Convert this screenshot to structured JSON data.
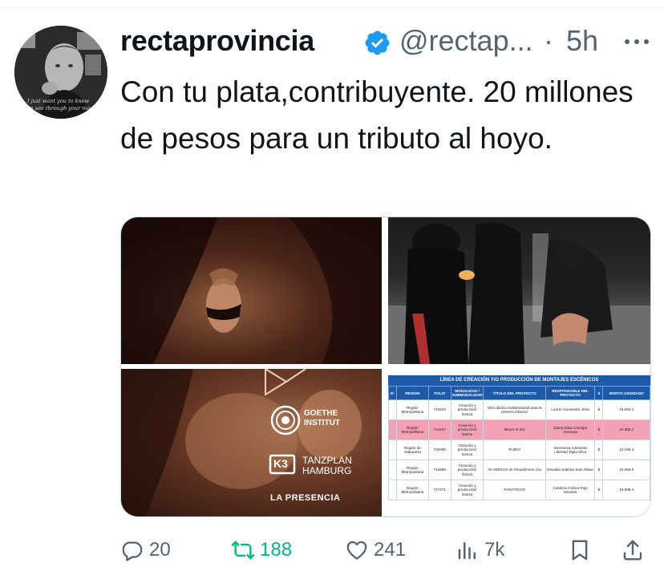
{
  "tweet": {
    "author_name": "rectaprovincia",
    "handle": "@rectap...",
    "separator": "·",
    "time": "5h",
    "text": "Con tu plata,contribuyente. 20 millones de pesos para un tributo al hoyo.",
    "avatar_caption_1": "I just want you to know",
    "avatar_caption_2": "can see through your mask"
  },
  "media": {
    "image_3": {
      "goethe_line1": "GOETHE",
      "goethe_line2": "INSTITUT",
      "tanzplan_line1": "TANZPLAN",
      "tanzplan_line2": "HAMBURG",
      "tanzplan_logo": "K3",
      "caption": "LA PRESENCIA"
    },
    "image_4": {
      "title": "LÍNEA DE CREACIÓN Y/O PRODUCCIÓN DE MONTAJES ESCÉNICOS",
      "headers": [
        "N°",
        "REGIÓN",
        "FOLIO",
        "MODALIDAD / SUBMODALIDAD",
        "TÍTULO DEL PROYECTO",
        "RESPONSABLE DEL PROYECTO",
        "$",
        "MONTO ASIGNADO"
      ],
      "rows": [
        [
          "",
          "Región Metropolitana",
          "716220",
          "Creación y producción/ Danza",
          "GEA danza multisensorial para la primera infancia",
          "Loreto Cavieedes Jerta",
          "$",
          "19.994.1"
        ],
        [
          "",
          "Región Metropolitana",
          "714187",
          "Creación y producción/ Danza",
          "Mover el Sur",
          "Diana Elisa Carvajal Guevara",
          "$",
          "19.955.2"
        ],
        [
          "",
          "Región de Valparaíso",
          "726480",
          "Creación y producción/ Danza",
          "RUIDO",
          "Genoveva Antonieta Libertad Tapia Silva",
          "$",
          "12.155.4"
        ],
        [
          "",
          "Región Metropolitana",
          "712885",
          "Creación y producción/ Danza",
          "IN VERSUS de Pseudónimo Cía",
          "Ninoska Sabrina Soto Olave",
          "$",
          "15.256.8"
        ],
        [
          "",
          "Región Metropolitana",
          "717471",
          "Creación y producción/ Danza",
          "FANÁTICOS",
          "Catalina Andrea Rojo Morales",
          "$",
          "19.999.4"
        ]
      ]
    }
  },
  "actions": {
    "replies": "20",
    "retweets": "188",
    "likes": "241",
    "views": "7k"
  },
  "colors": {
    "verified": "#1d9bf0",
    "retweet_active": "#00ba7c",
    "muted": "#536471",
    "table_header": "#1e5aa8",
    "highlight": "#f4a0b6"
  },
  "icons": [
    "verified-badge-icon",
    "more-icon",
    "reply-icon",
    "retweet-icon",
    "like-icon",
    "views-icon",
    "bookmark-icon",
    "share-icon"
  ]
}
